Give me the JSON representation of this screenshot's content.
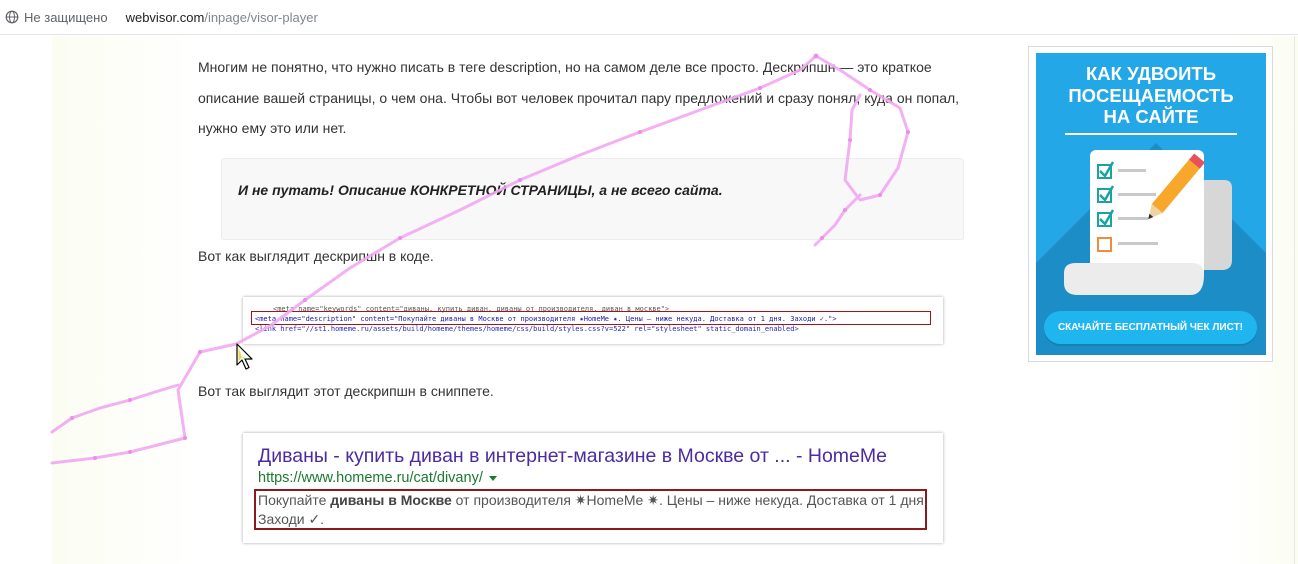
{
  "addressbar": {
    "security_label": "Не защищено",
    "host": "webvisor.com",
    "path": "/inpage/visor-player"
  },
  "article": {
    "intro": "Многим не понятно, что нужно писать в теге description, но на самом деле все просто. Дескрипшн — это краткое описание вашей страницы, о чем она. Чтобы вот человек прочитал пару предложений и сразу понял, куда он попал, нужно ему это или нет.",
    "callout": "И не путать! Описание КОНКРЕТНОЙ СТРАНИЦЫ, а не всего сайта.",
    "code_caption": "Вот как выглядит дескрипшн в коде.",
    "snippet_caption": "Вот так выглядит этот дескрипшн в сниппете."
  },
  "code_image": {
    "line1": "<meta name=\"keywords\" content=\"диваны, купить диван, диваны от производителя, диван в москве\">",
    "line2": "<meta name=\"description\" content=\"Покупайте диваны в Москве от производителя ✷HomeMe ✷. Цены – ниже некуда. Доставка от 1 дня. Заходи ✓.\">",
    "line3": "<link href=\"//st1.homeme.ru/assets/build/homeme/themes/homeme/css/build/styles.css?v=522\" rel=\"stylesheet\" static_domain_enabled>"
  },
  "snippet": {
    "title": "Диваны - купить диван в интернет-магазине в Москве от ... - HomeMe",
    "url": "https://www.homeme.ru/cat/divany/",
    "desc_pre": "Покупайте ",
    "desc_bold": "диваны в Москве",
    "desc_post": " от производителя ✷HomeMe ✷. Цены – ниже некуда. Доставка от 1 дня. Заходи ✓."
  },
  "ad": {
    "title_line1": "КАК УДВОИТЬ",
    "title_line2": "ПОСЕЩАЕМОСТЬ",
    "title_line3": "НА САЙТЕ",
    "cta": "СКАЧАЙТЕ БЕСПЛАТНЫЙ ЧЕК ЛИСТ!",
    "colors": {
      "background": "#23a7e6",
      "shadow": "#1d8dc7",
      "cta": "#1fb6f0",
      "check": "#1aa3a3",
      "empty_box": "#f08a3c",
      "pencil": "#f7a72a"
    }
  },
  "trail": {
    "color": "#f2a8f2",
    "icon": "mouse-cursor-icon"
  }
}
